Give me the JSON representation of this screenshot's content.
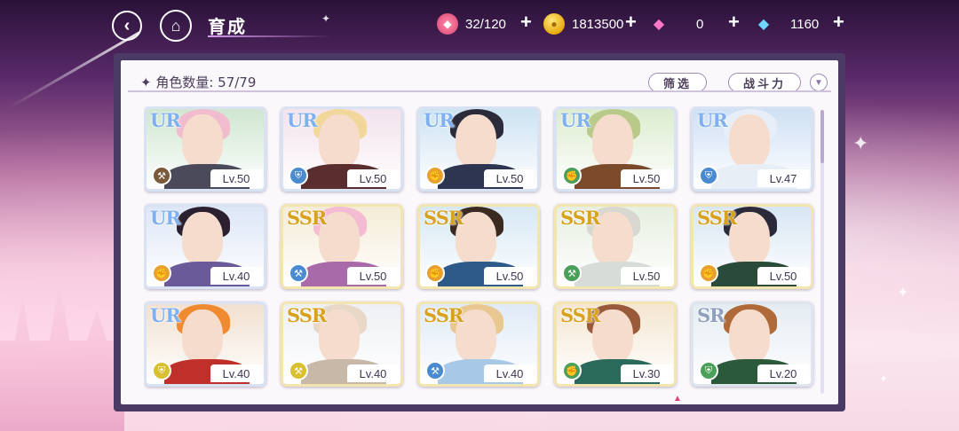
{
  "header": {
    "title": "育成",
    "back_icon": "back-arrow-icon",
    "home_icon": "castle-home-icon"
  },
  "resources": [
    {
      "name": "candy",
      "icon": "candy-icon",
      "value": "32/120",
      "plus": "+"
    },
    {
      "name": "coin",
      "icon": "coin-icon",
      "value": "1813500",
      "plus": "+"
    },
    {
      "name": "pink-gem",
      "icon": "pink-diamond-icon",
      "value": "0",
      "plus": "+"
    },
    {
      "name": "blue-gem",
      "icon": "blue-diamond-icon",
      "value": "1160",
      "plus": "+"
    }
  ],
  "panel": {
    "count_label": "✦ 角色数量: 57/79",
    "filter_label": "筛选",
    "sort_label": "战斗力",
    "sort_dir_icon": "chevron-down-icon"
  },
  "cards": [
    {
      "rarity": "UR",
      "level": "Lv.50",
      "role": "hammer",
      "role_color": "#7a5a3a",
      "hair": "#f2bccf",
      "outfit": "#4a4a5a",
      "bg": "#cfe6d0"
    },
    {
      "rarity": "UR",
      "level": "Lv.50",
      "role": "shield",
      "role_color": "#4a8ad0",
      "hair": "#f1d79a",
      "outfit": "#5a2e2e",
      "bg": "#f3e2ec"
    },
    {
      "rarity": "UR",
      "level": "Lv.50",
      "role": "fist",
      "role_color": "#e8a030",
      "hair": "#2b2b3a",
      "outfit": "#2e3550",
      "bg": "#cde3f2"
    },
    {
      "rarity": "UR",
      "level": "Lv.50",
      "role": "fist",
      "role_color": "#4aa058",
      "hair": "#b8c98a",
      "outfit": "#7a4a2a",
      "bg": "#dceccf"
    },
    {
      "rarity": "UR",
      "level": "Lv.47",
      "role": "shield",
      "role_color": "#4a8ad0",
      "hair": "#e8eef8",
      "outfit": "#e8eef6",
      "bg": "#cfe0f4"
    },
    {
      "rarity": "UR",
      "level": "Lv.40",
      "role": "fist",
      "role_color": "#e8a030",
      "hair": "#2a2030",
      "outfit": "#6a5a9a",
      "bg": "#dde6f6"
    },
    {
      "rarity": "SSR",
      "level": "Lv.50",
      "role": "hammer",
      "role_color": "#4a8ad0",
      "hair": "#f3bcd2",
      "outfit": "#a86aa8",
      "bg": "#f4ecd6"
    },
    {
      "rarity": "SSR",
      "level": "Lv.50",
      "role": "fist",
      "role_color": "#e8a030",
      "hair": "#3a2a20",
      "outfit": "#2e5a8a",
      "bg": "#d6e8f4"
    },
    {
      "rarity": "SSR",
      "level": "Lv.50",
      "role": "hammer",
      "role_color": "#4aa058",
      "hair": "#d8d8d0",
      "outfit": "#d8dcd8",
      "bg": "#e6efe0"
    },
    {
      "rarity": "SSR",
      "level": "Lv.50",
      "role": "fist",
      "role_color": "#e8a030",
      "hair": "#2a2a3a",
      "outfit": "#2a4a3a",
      "bg": "#d8e6f4"
    },
    {
      "rarity": "UR",
      "level": "Lv.40",
      "role": "shield",
      "role_color": "#d8c030",
      "hair": "#f08a30",
      "outfit": "#c0302a",
      "bg": "#f1e0d0"
    },
    {
      "rarity": "SSR",
      "level": "Lv.40",
      "role": "hammer",
      "role_color": "#d8c030",
      "hair": "#e8d8c8",
      "outfit": "#c8b8a8",
      "bg": "#eef0f4"
    },
    {
      "rarity": "SSR",
      "level": "Lv.40",
      "role": "hammer",
      "role_color": "#4a8ad0",
      "hair": "#e8c890",
      "outfit": "#a8c8e8",
      "bg": "#dfeaf6"
    },
    {
      "rarity": "SSR",
      "level": "Lv.30",
      "role": "fist",
      "role_color": "#4aa058",
      "hair": "#9a5a3a",
      "outfit": "#2a6a5a",
      "bg": "#f4e6d0"
    },
    {
      "rarity": "SR",
      "level": "Lv.20",
      "role": "shield",
      "role_color": "#4aa058",
      "hair": "#b06a3a",
      "outfit": "#2a5a3a",
      "bg": "#e4ecf2"
    }
  ],
  "colors": {
    "panel_frame": "#4b3a63",
    "panel_bg": "#fbf8fc",
    "ur": "#7fb0f0",
    "ssr": "#d9a21e",
    "sr": "#8fa0bf"
  }
}
